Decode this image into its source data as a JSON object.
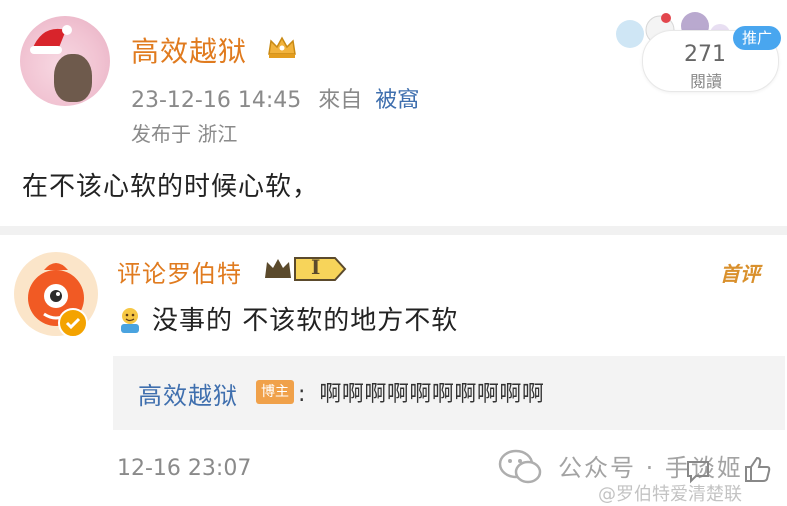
{
  "post": {
    "author": "高效越狱",
    "timestamp": "23-12-16 14:45",
    "source_prefix": "來自",
    "source": "被窩",
    "location": "发布于 浙江",
    "text": "在不该心软的时候心软，",
    "reads": {
      "count": "271",
      "label": "閱讀"
    },
    "promo_tag": "推广"
  },
  "comment": {
    "author": "评论罗伯特",
    "badge_level": "I",
    "first_label": "首评",
    "text": "没事的 不该软的地方不软",
    "reply": {
      "author": "高效越狱",
      "role_tag": "博主",
      "separator": ":",
      "text": "啊啊啊啊啊啊啊啊啊啊"
    },
    "timestamp": "12-16 23:07"
  },
  "watermark": {
    "text": "公众号 · 手谈姬",
    "handle": "@罗伯特爱清楚联"
  },
  "icons": {
    "post_badge": "crown-icon",
    "comment_emoji": "smiley-emoji-icon",
    "reply": "comment-icon",
    "like": "thumbs-up-icon"
  },
  "colors": {
    "author_orange": "#e07b1f",
    "link_blue": "#3f6fae",
    "promo_blue": "#49a6ef",
    "blogger_tag": "#f0a14a"
  }
}
